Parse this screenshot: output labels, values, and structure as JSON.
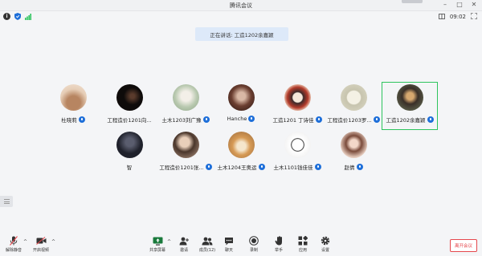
{
  "window": {
    "title": "腾讯会议"
  },
  "infobar": {
    "timer": "09:02"
  },
  "speaking": {
    "text": "正在讲话: 工造1202余嘉颖"
  },
  "participants": [
    {
      "name": "杜晓莉",
      "avatar_color": "#d8b59a"
    },
    {
      "name": "工程造价1201向...",
      "avatar_color": "#1a1412"
    },
    {
      "name": "土木1203刘广豫",
      "avatar_color": "#c9d6c4"
    },
    {
      "name": "Hanche",
      "avatar_color": "#7a4a3a"
    },
    {
      "name": "工造1201 丁诗佳",
      "avatar_color": "#f0e2d2"
    },
    {
      "name": "工程造价1203罗...",
      "avatar_color": "#d7d5c4"
    },
    {
      "name": "工造1202余嘉颖",
      "avatar_color": "#3a2f28"
    },
    {
      "name": "智",
      "avatar_color": "#2b2d3a"
    },
    {
      "name": "工程造价1201张...",
      "avatar_color": "#c9b09c"
    },
    {
      "name": "土木1204王奥运",
      "avatar_color": "#d69a55"
    },
    {
      "name": "土木1101钱佳佳",
      "avatar_color": "#eeeeee"
    },
    {
      "name": "赵倩",
      "avatar_color": "#e8c8bc"
    }
  ],
  "toolbar": {
    "mute": "解除静音",
    "video": "开启视频",
    "share": "共享屏幕",
    "invite": "邀请",
    "members": "成员(12)",
    "chat": "聊天",
    "record": "录制",
    "raise_hand": "举手",
    "apps": "应用",
    "settings": "设置",
    "leave": "离开会议"
  },
  "colors": {
    "accent": "#1e6fd9",
    "active_border": "#2ec45e",
    "leave": "#e5484d"
  }
}
